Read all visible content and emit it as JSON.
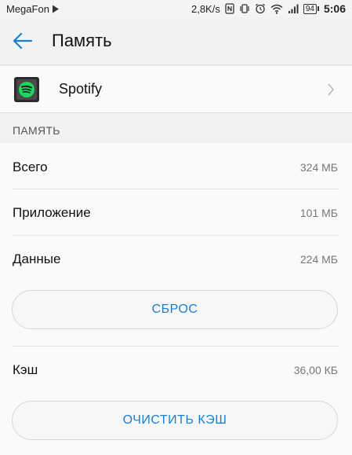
{
  "status_bar": {
    "carrier": "MegaFon",
    "speed": "2,8K/s",
    "battery": "94",
    "time": "5:06"
  },
  "header": {
    "title": "Память"
  },
  "app": {
    "name": "Spotify"
  },
  "section": {
    "title": "ПАМЯТЬ"
  },
  "storage": {
    "total_label": "Всего",
    "total_value": "324 МБ",
    "app_label": "Приложение",
    "app_value": "101 МБ",
    "data_label": "Данные",
    "data_value": "224 МБ",
    "reset_button": "СБРОС",
    "cache_label": "Кэш",
    "cache_value": "36,00 КБ",
    "clear_cache_button": "ОЧИСТИТЬ КЭШ"
  },
  "colors": {
    "accent": "#1a7fd1",
    "spotify_green": "#1ed760"
  }
}
